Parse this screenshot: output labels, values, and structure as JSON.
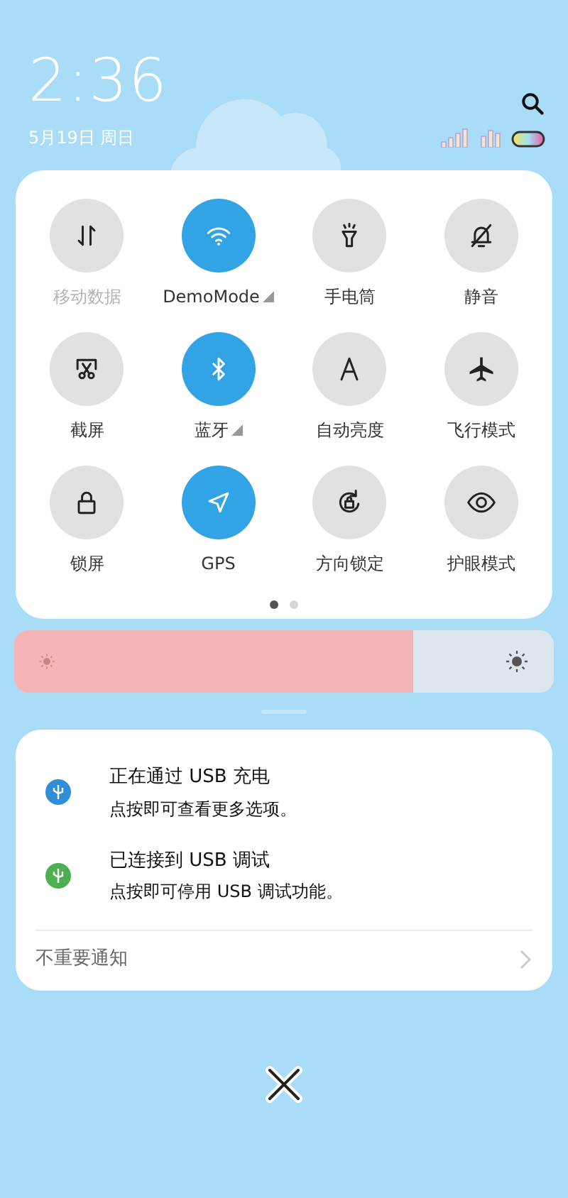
{
  "header": {
    "time": "2:36",
    "date": "5月19日 周日"
  },
  "tiles": [
    {
      "label": "移动数据",
      "on": false,
      "disabled": true,
      "has_menu": false
    },
    {
      "label": "DemoMode",
      "on": true,
      "disabled": false,
      "has_menu": true
    },
    {
      "label": "手电筒",
      "on": false,
      "disabled": false,
      "has_menu": false
    },
    {
      "label": "静音",
      "on": false,
      "disabled": false,
      "has_menu": false
    },
    {
      "label": "截屏",
      "on": false,
      "disabled": false,
      "has_menu": false
    },
    {
      "label": "蓝牙",
      "on": true,
      "disabled": false,
      "has_menu": true
    },
    {
      "label": "自动亮度",
      "on": false,
      "disabled": false,
      "has_menu": false
    },
    {
      "label": "飞行模式",
      "on": false,
      "disabled": false,
      "has_menu": false
    },
    {
      "label": "锁屏",
      "on": false,
      "disabled": false,
      "has_menu": false
    },
    {
      "label": "GPS",
      "on": true,
      "disabled": false,
      "has_menu": false
    },
    {
      "label": "方向锁定",
      "on": false,
      "disabled": false,
      "has_menu": false
    },
    {
      "label": "护眼模式",
      "on": false,
      "disabled": false,
      "has_menu": false
    }
  ],
  "pages": [
    {
      "selected": true
    },
    {
      "selected": false
    }
  ],
  "brightness": {
    "level": 0.74
  },
  "notifications": [
    {
      "title": "正在通过 USB 充电",
      "text": "点按即可查看更多选项。"
    },
    {
      "title": "已连接到 USB 调试",
      "text": "点按即可停用 USB 调试功能。"
    }
  ],
  "footer": {
    "label": "不重要通知"
  }
}
